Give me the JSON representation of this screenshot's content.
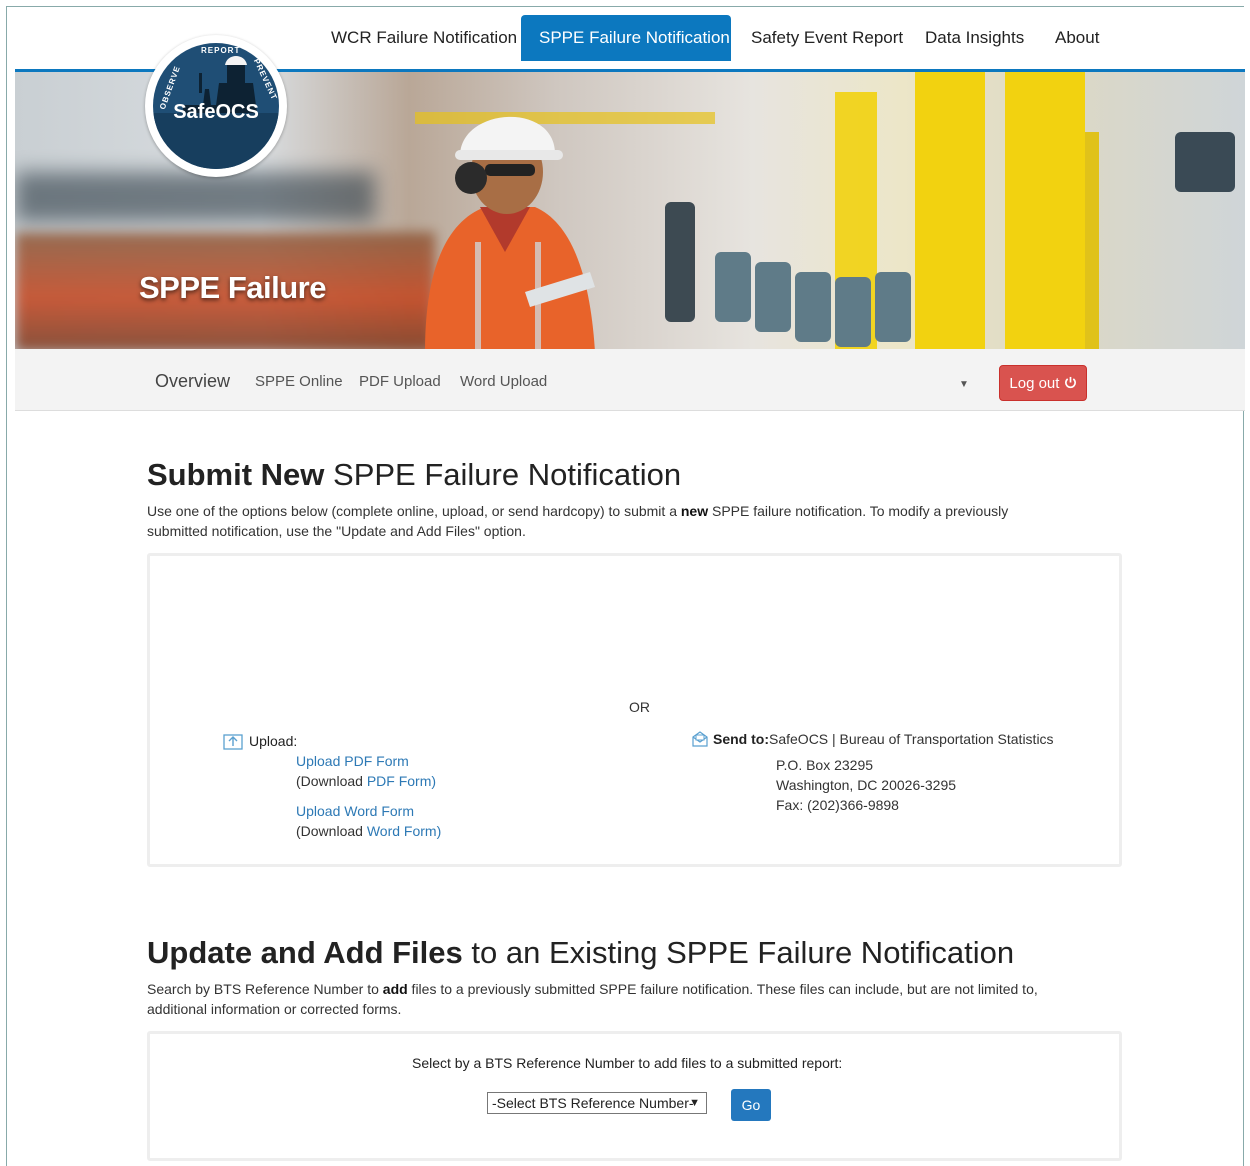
{
  "topnav": {
    "items": [
      {
        "label": "WCR Failure Notification"
      },
      {
        "label": "SPPE Failure Notification"
      },
      {
        "label": "Safety Event Report"
      },
      {
        "label": "Data Insights"
      },
      {
        "label": "About"
      }
    ],
    "active_index": 1,
    "accent": "#0c78bf"
  },
  "logo": {
    "name": "SafeOCS",
    "arc_top": "REPORT",
    "arc_left": "OBSERVE",
    "arc_right": "PREVENT"
  },
  "hero": {
    "title": "SPPE Failure"
  },
  "subnav": {
    "items": [
      "Overview",
      "SPPE Online",
      "PDF Upload",
      "Word Upload"
    ],
    "logout_label": "Log out",
    "logout_color": "#d9534f"
  },
  "submit": {
    "title_bold": "Submit New",
    "title_rest": " SPPE Failure Notification",
    "desc_1": "Use one of the options below (complete online, upload, or send hardcopy) to submit a ",
    "desc_bold": "new",
    "desc_2": " SPPE failure notification. To modify a previously submitted notification, use the \"Update and Add Files\" option.",
    "or_label": "OR",
    "upload_label": "Upload:",
    "upload_pdf": "Upload PDF Form",
    "download_pdf_prefix": "(Download ",
    "download_pdf_link": "PDF Form)",
    "upload_word": "Upload Word Form",
    "download_word_prefix": "(Download ",
    "download_word_link": "Word Form)",
    "send_label": "Send to:",
    "send_org": "SafeOCS | Bureau of Transportation Statistics",
    "addr_1": "P.O. Box 23295",
    "addr_2": "Washington, DC 20026-3295",
    "fax": "Fax: (202)366-9898"
  },
  "update": {
    "title_bold": "Update and Add Files",
    "title_rest": " to an Existing SPPE Failure Notification",
    "desc_1": "Search by BTS Reference Number to ",
    "desc_bold": "add",
    "desc_2": " files to a previously submitted SPPE failure notification. These files can include, but are not limited to, additional information or corrected forms.",
    "select_prompt": "Select by a BTS Reference Number to add files to a submitted report:",
    "select_value": "-Select BTS Reference Number-",
    "go_label": "Go"
  }
}
